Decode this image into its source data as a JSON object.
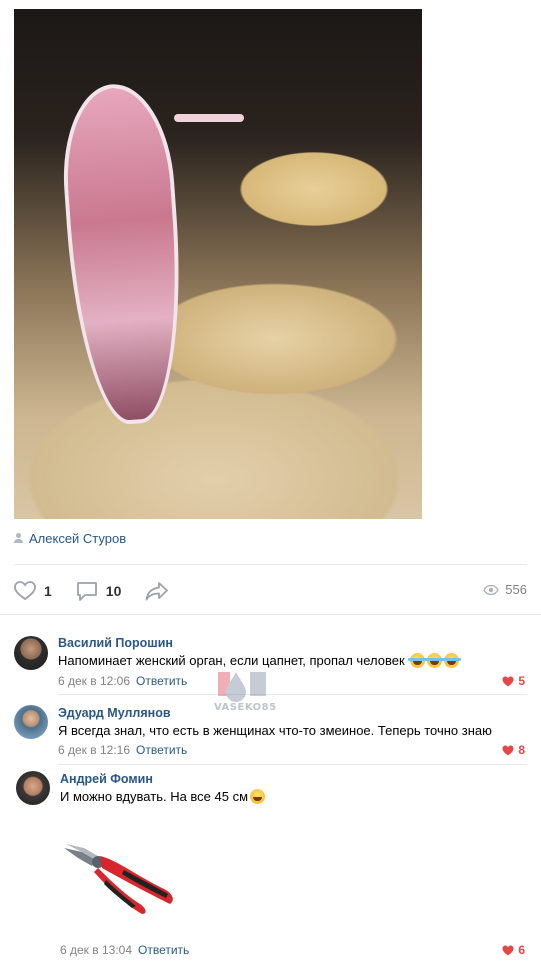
{
  "post": {
    "author": "Алексей Стуров",
    "likes": "1",
    "comments_count": "10",
    "views": "556"
  },
  "watermark_text": "VASEKO85",
  "comments": [
    {
      "name": "Василий Порошин",
      "text": "Напоминает женский орган, если цапнет, пропал человек",
      "date": "6 дек в 12:06",
      "reply": "Ответить",
      "likes": "5",
      "emoji": [
        "tears-of-joy",
        "tears-of-joy",
        "tears-of-joy"
      ]
    },
    {
      "name": "Эдуард Муллянов",
      "text": "Я всегда знал, что есть в женщинах что-то змеиное. Теперь точно знаю",
      "date": "6 дек в 12:16",
      "reply": "Ответить",
      "likes": "8"
    },
    {
      "name": "Андрей Фомин",
      "text": "И можно вдувать. На все 45 см",
      "date": "6 дек в 13:04",
      "reply": "Ответить",
      "likes": "6",
      "emoji": [
        "winking-face"
      ],
      "attachment_icon": "pliers-icon"
    }
  ],
  "colors": {
    "link": "#2a5885",
    "like_red": "#e64646",
    "meta_gray": "#828282",
    "icon_gray": "#aeb7c2",
    "divider": "#e7e8ec"
  }
}
